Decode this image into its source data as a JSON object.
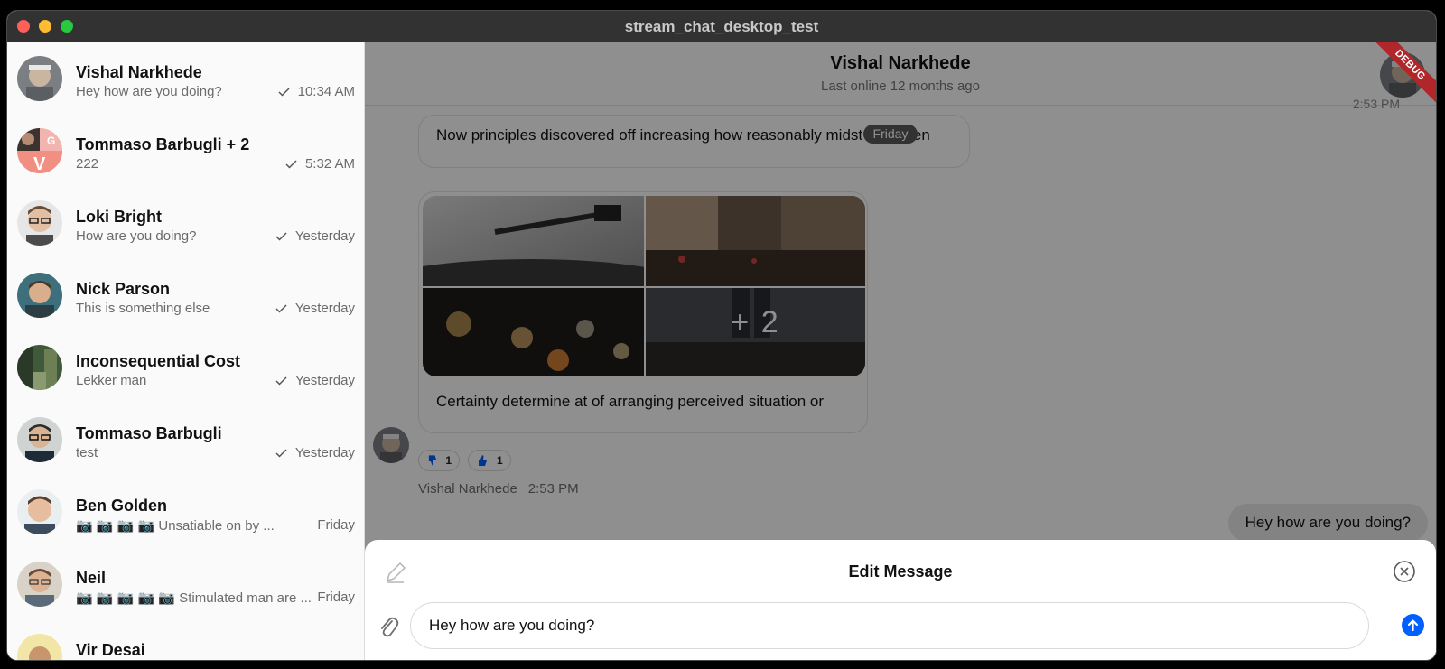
{
  "window": {
    "title": "stream_chat_desktop_test"
  },
  "channels": [
    {
      "name": "Vishal Narkhede",
      "preview": "Hey how are you doing?",
      "time": "10:34 AM",
      "read": true
    },
    {
      "name": "Tommaso Barbugli + 2",
      "preview": "222",
      "time": "5:32 AM",
      "read": true
    },
    {
      "name": "Loki Bright",
      "preview": "How are you doing?",
      "time": "Yesterday",
      "read": true
    },
    {
      "name": "Nick Parson",
      "preview": "This is something else",
      "time": "Yesterday",
      "read": true
    },
    {
      "name": "Inconsequential Cost",
      "preview": "Lekker man",
      "time": "Yesterday",
      "read": true
    },
    {
      "name": "Tommaso Barbugli",
      "preview": "test",
      "time": "Yesterday",
      "read": true
    },
    {
      "name": "Ben Golden",
      "preview": "📷 📷 📷 📷 Unsatiable on by ...",
      "time": "Friday",
      "read": false
    },
    {
      "name": "Neil",
      "preview": "📷 📷 📷 📷 📷 Stimulated man are ...",
      "time": "Friday",
      "read": false
    },
    {
      "name": "Vir Desai",
      "preview": "",
      "time": "",
      "read": false
    }
  ],
  "header": {
    "title": "Vishal Narkhede",
    "subtitle": "Last online 12 months ago",
    "debug_label": "DEBUG",
    "partial_time": "2:53 PM"
  },
  "messages": {
    "first_text": "Now principles discovered off increasing how reasonably midst tons men",
    "date_separator": "Friday",
    "gallery_more": "+ 2",
    "second_text": "Certainty determine at of arranging perceived situation or",
    "reactions": [
      {
        "icon": "thumbs-down-icon",
        "count": "1"
      },
      {
        "icon": "thumbs-up-icon",
        "count": "1"
      }
    ],
    "author": "Vishal Narkhede",
    "time": "2:53 PM",
    "outgoing_text": "Hey how are you doing?"
  },
  "edit": {
    "title": "Edit Message",
    "input_value": "Hey how are you doing?"
  },
  "colors": {
    "accent": "#005fff",
    "debug_banner": "#b1262a",
    "overlay": "rgba(0,0,0,0.44)"
  }
}
